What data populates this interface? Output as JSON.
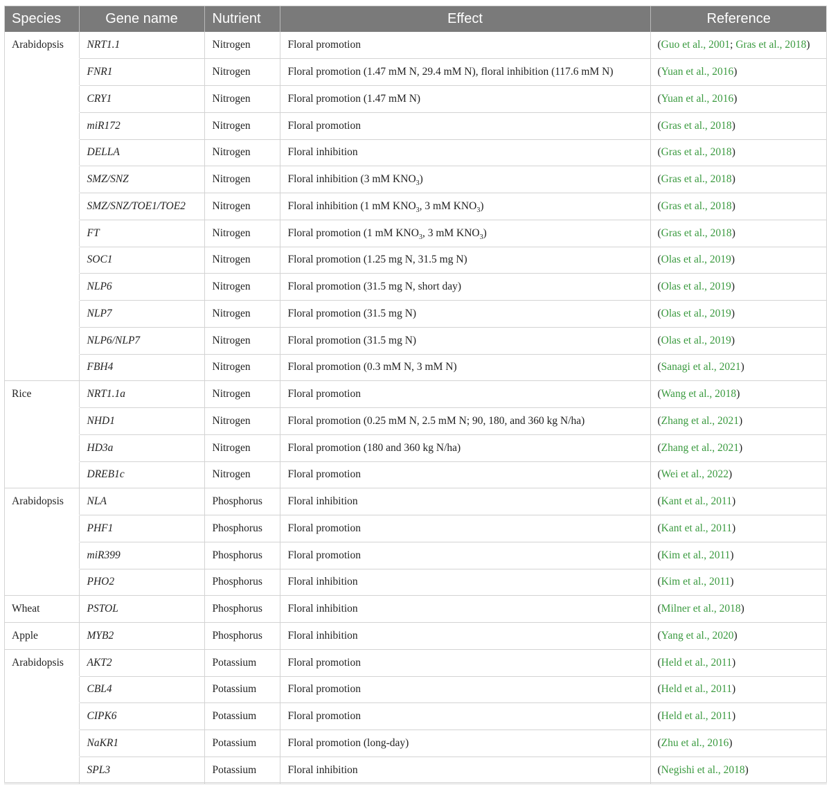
{
  "headers": {
    "species": "Species",
    "gene": "Gene name",
    "nutrient": "Nutrient",
    "effect": "Effect",
    "reference": "Reference"
  },
  "rows": [
    {
      "species": "Arabidopsis",
      "gene": "NRT1.1",
      "nutrient": "Nitrogen",
      "effect": "Floral promotion",
      "refs": [
        "Guo et al., 2001",
        "Gras et al., 2018"
      ]
    },
    {
      "species": "",
      "gene": "FNR1",
      "nutrient": "Nitrogen",
      "effect": "Floral promotion (1.47 mM N, 29.4 mM N), floral inhibition (117.6 mM N)",
      "refs": [
        "Yuan et al., 2016"
      ]
    },
    {
      "species": "",
      "gene": "CRY1",
      "nutrient": "Nitrogen",
      "effect": "Floral promotion (1.47 mM N)",
      "refs": [
        "Yuan et al., 2016"
      ]
    },
    {
      "species": "",
      "gene": "miR172",
      "nutrient": "Nitrogen",
      "effect": "Floral promotion",
      "refs": [
        "Gras et al., 2018"
      ]
    },
    {
      "species": "",
      "gene": "DELLA",
      "nutrient": "Nitrogen",
      "effect": "Floral inhibition",
      "refs": [
        "Gras et al., 2018"
      ]
    },
    {
      "species": "",
      "gene": "SMZ/SNZ",
      "nutrient": "Nitrogen",
      "effect": "Floral inhibition (3 mM KNO₃)",
      "refs": [
        "Gras et al., 2018"
      ]
    },
    {
      "species": "",
      "gene": "SMZ/SNZ/TOE1/TOE2",
      "nutrient": "Nitrogen",
      "effect": "Floral inhibition (1 mM KNO₃, 3 mM KNO₃)",
      "refs": [
        "Gras et al., 2018"
      ]
    },
    {
      "species": "",
      "gene": "FT",
      "nutrient": "Nitrogen",
      "effect": "Floral promotion (1 mM KNO₃, 3 mM KNO₃)",
      "refs": [
        "Gras et al., 2018"
      ]
    },
    {
      "species": "",
      "gene": "SOC1",
      "nutrient": "Nitrogen",
      "effect": "Floral promotion (1.25 mg N, 31.5 mg N)",
      "refs": [
        "Olas et al., 2019"
      ]
    },
    {
      "species": "",
      "gene": "NLP6",
      "nutrient": "Nitrogen",
      "effect": "Floral promotion (31.5 mg N, short day)",
      "refs": [
        "Olas et al., 2019"
      ]
    },
    {
      "species": "",
      "gene": "NLP7",
      "nutrient": "Nitrogen",
      "effect": "Floral promotion (31.5 mg N)",
      "refs": [
        "Olas et al., 2019"
      ]
    },
    {
      "species": "",
      "gene": "NLP6/NLP7",
      "nutrient": "Nitrogen",
      "effect": "Floral promotion (31.5 mg N)",
      "refs": [
        "Olas et al., 2019"
      ]
    },
    {
      "species": "",
      "gene": "FBH4",
      "nutrient": "Nitrogen",
      "effect": "Floral promotion (0.3 mM N, 3 mM N)",
      "refs": [
        "Sanagi et al., 2021"
      ]
    },
    {
      "species": "Rice",
      "gene": "NRT1.1a",
      "nutrient": "Nitrogen",
      "effect": "Floral promotion",
      "refs": [
        "Wang et al., 2018"
      ]
    },
    {
      "species": "",
      "gene": "NHD1",
      "nutrient": "Nitrogen",
      "effect": "Floral promotion (0.25 mM N, 2.5 mM N; 90, 180, and 360 kg N/ha)",
      "refs": [
        "Zhang et al., 2021"
      ]
    },
    {
      "species": "",
      "gene": "HD3a",
      "nutrient": "Nitrogen",
      "effect": "Floral promotion (180 and 360 kg N/ha)",
      "refs": [
        "Zhang et al., 2021"
      ]
    },
    {
      "species": "",
      "gene": "DREB1c",
      "nutrient": "Nitrogen",
      "effect": "Floral promotion",
      "refs": [
        "Wei et al., 2022"
      ]
    },
    {
      "species": "Arabidopsis",
      "gene": "NLA",
      "nutrient": "Phosphorus",
      "effect": "Floral inhibition",
      "refs": [
        "Kant et al., 2011"
      ]
    },
    {
      "species": "",
      "gene": "PHF1",
      "nutrient": "Phosphorus",
      "effect": "Floral promotion",
      "refs": [
        "Kant et al., 2011"
      ]
    },
    {
      "species": "",
      "gene": "miR399",
      "nutrient": "Phosphorus",
      "effect": "Floral promotion",
      "refs": [
        "Kim et al., 2011"
      ]
    },
    {
      "species": "",
      "gene": "PHO2",
      "nutrient": "Phosphorus",
      "effect": "Floral inhibition",
      "refs": [
        "Kim et al., 2011"
      ]
    },
    {
      "species": "Wheat",
      "gene": "PSTOL",
      "nutrient": "Phosphorus",
      "effect": "Floral inhibition",
      "refs": [
        "Milner et al., 2018"
      ]
    },
    {
      "species": "Apple",
      "gene": "MYB2",
      "nutrient": "Phosphorus",
      "effect": "Floral inhibition",
      "refs": [
        "Yang et al., 2020"
      ]
    },
    {
      "species": "Arabidopsis",
      "gene": "AKT2",
      "nutrient": "Potassium",
      "effect": "Floral promotion",
      "refs": [
        "Held et al., 2011"
      ]
    },
    {
      "species": "",
      "gene": "CBL4",
      "nutrient": "Potassium",
      "effect": "Floral promotion",
      "refs": [
        "Held et al., 2011"
      ]
    },
    {
      "species": "",
      "gene": "CIPK6",
      "nutrient": "Potassium",
      "effect": "Floral promotion",
      "refs": [
        "Held et al., 2011"
      ]
    },
    {
      "species": "",
      "gene": "NaKR1",
      "nutrient": "Potassium",
      "effect": "Floral promotion (long-day)",
      "refs": [
        "Zhu et al., 2016"
      ]
    },
    {
      "species": "",
      "gene": "SPL3",
      "nutrient": "Potassium",
      "effect": "Floral inhibition",
      "refs": [
        "Negishi et al., 2018"
      ]
    }
  ],
  "ref_open": "(",
  "ref_separator": "; ",
  "ref_close": ")",
  "colors": {
    "header_bg": "#7a7a7a",
    "header_text": "#ffffff",
    "citation": "#3a9a3f",
    "grid": "#d3d3d3"
  }
}
